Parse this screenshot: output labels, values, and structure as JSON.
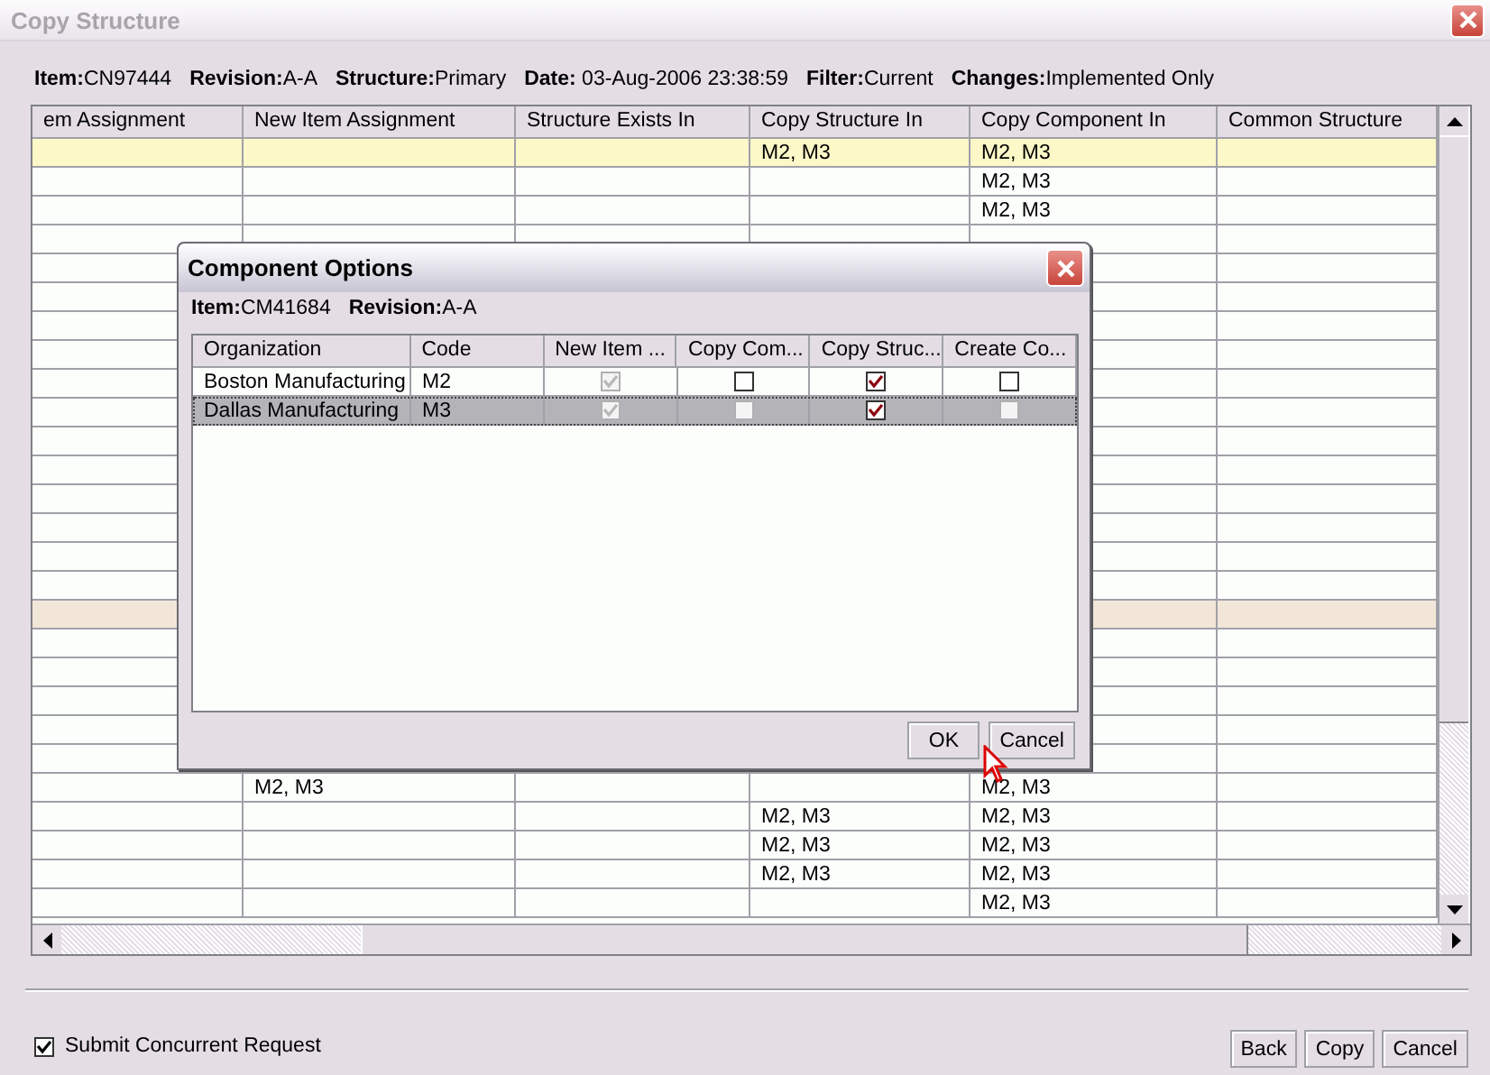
{
  "window": {
    "title": "Copy Structure"
  },
  "info": [
    "**Item:**CN97444",
    "**Revision:**A-A",
    "**Structure:**Primary",
    "**Date:** 03-Aug-2006 23:38:59",
    "**Filter:**Current",
    "**Changes:**Implemented Only"
  ],
  "table": {
    "columns": [
      "em Assignment",
      "New Item Assignment",
      "Structure Exists In",
      "Copy Structure In",
      "Copy Component In",
      "Common Structure"
    ],
    "rows": [
      {
        "selected": true,
        "shaded": false,
        "cells": [
          "",
          "",
          "",
          "M2, M3",
          "M2, M3",
          ""
        ]
      },
      {
        "selected": false,
        "shaded": false,
        "cells": [
          "",
          "",
          "",
          "",
          "M2, M3",
          ""
        ]
      },
      {
        "selected": false,
        "shaded": false,
        "cells": [
          "",
          "",
          "",
          "",
          "M2, M3",
          ""
        ]
      },
      {
        "selected": false,
        "shaded": false,
        "cells": [
          "",
          "",
          "",
          "",
          "",
          ""
        ]
      },
      {
        "selected": false,
        "shaded": false,
        "cells": [
          "",
          "",
          "",
          "",
          "",
          ""
        ]
      },
      {
        "selected": false,
        "shaded": false,
        "cells": [
          "",
          "",
          "",
          "",
          "",
          ""
        ]
      },
      {
        "selected": false,
        "shaded": false,
        "cells": [
          "",
          "",
          "",
          "",
          "",
          ""
        ]
      },
      {
        "selected": false,
        "shaded": false,
        "cells": [
          "",
          "",
          "",
          "",
          "",
          ""
        ]
      },
      {
        "selected": false,
        "shaded": false,
        "cells": [
          "",
          "",
          "",
          "",
          "",
          ""
        ]
      },
      {
        "selected": false,
        "shaded": false,
        "cells": [
          "",
          "",
          "",
          "",
          "",
          ""
        ]
      },
      {
        "selected": false,
        "shaded": false,
        "cells": [
          "",
          "",
          "",
          "",
          "",
          ""
        ]
      },
      {
        "selected": false,
        "shaded": false,
        "cells": [
          "",
          "",
          "",
          "",
          "",
          ""
        ]
      },
      {
        "selected": false,
        "shaded": false,
        "cells": [
          "",
          "",
          "",
          "",
          "",
          ""
        ]
      },
      {
        "selected": false,
        "shaded": false,
        "cells": [
          "",
          "",
          "",
          "",
          "",
          ""
        ]
      },
      {
        "selected": false,
        "shaded": false,
        "cells": [
          "",
          "",
          "",
          "",
          "",
          ""
        ]
      },
      {
        "selected": false,
        "shaded": false,
        "cells": [
          "",
          "",
          "",
          "",
          "",
          ""
        ]
      },
      {
        "selected": false,
        "shaded": true,
        "cells": [
          "",
          "",
          "",
          "",
          "",
          ""
        ]
      },
      {
        "selected": false,
        "shaded": false,
        "cells": [
          "",
          "",
          "",
          "",
          "",
          ""
        ]
      },
      {
        "selected": false,
        "shaded": false,
        "cells": [
          "",
          "",
          "",
          "",
          "",
          ""
        ]
      },
      {
        "selected": false,
        "shaded": false,
        "cells": [
          "",
          "",
          "",
          "",
          "",
          ""
        ]
      },
      {
        "selected": false,
        "shaded": false,
        "cells": [
          "",
          "",
          "",
          "",
          "",
          ""
        ]
      },
      {
        "selected": false,
        "shaded": false,
        "cells": [
          "",
          "",
          "",
          "",
          "",
          ""
        ]
      },
      {
        "selected": false,
        "shaded": false,
        "cells": [
          "",
          "M2, M3",
          "",
          "",
          "M2, M3",
          ""
        ]
      },
      {
        "selected": false,
        "shaded": false,
        "cells": [
          "",
          "",
          "",
          "M2, M3",
          "M2, M3",
          ""
        ]
      },
      {
        "selected": false,
        "shaded": false,
        "cells": [
          "",
          "",
          "",
          "M2, M3",
          "M2, M3",
          ""
        ]
      },
      {
        "selected": false,
        "shaded": false,
        "cells": [
          "",
          "",
          "",
          "M2, M3",
          "M2, M3",
          ""
        ]
      },
      {
        "selected": false,
        "shaded": false,
        "cells": [
          "",
          "",
          "",
          "",
          "M2, M3",
          ""
        ]
      }
    ]
  },
  "dialog": {
    "title": "Component Options",
    "info": [
      "**Item:**CM41684",
      "**Revision:**A-A"
    ],
    "columns": [
      "Organization",
      "Code",
      "New Item ...",
      "Copy Com...",
      "Copy Struc...",
      "Create Co..."
    ],
    "rows": [
      {
        "selected": false,
        "organization": "Boston Manufacturing",
        "code": "M2",
        "options": [
          {
            "checked": true,
            "disabled": true
          },
          {
            "checked": false,
            "disabled": false
          },
          {
            "checked": true,
            "disabled": false
          },
          {
            "checked": false,
            "disabled": false
          }
        ]
      },
      {
        "selected": true,
        "organization": "Dallas Manufacturing",
        "code": "M3",
        "options": [
          {
            "checked": true,
            "disabled": true
          },
          {
            "checked": false,
            "disabled": true
          },
          {
            "checked": true,
            "disabled": false
          },
          {
            "checked": false,
            "disabled": true
          }
        ]
      }
    ],
    "buttons": [
      "OK",
      "Cancel"
    ]
  },
  "submit_request": {
    "label": "Submit Concurrent Request",
    "checked": true
  },
  "buttons": [
    "Back",
    "Copy",
    "Cancel"
  ]
}
